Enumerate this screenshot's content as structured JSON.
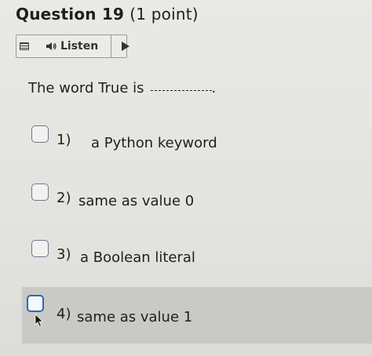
{
  "question": {
    "title": "Question 19",
    "points": "(1 point)",
    "prompt": "The word True is",
    "prompt_end": "."
  },
  "listen_bar": {
    "label": "Listen",
    "icons": [
      "menu-icon",
      "speaker-icon",
      "play-icon"
    ]
  },
  "options": [
    {
      "number": "1)",
      "text": "a Python keyword"
    },
    {
      "number": "2)",
      "text": "same as value 0"
    },
    {
      "number": "3)",
      "text": "a Boolean literal"
    },
    {
      "number": "4)",
      "text": "same as value 1"
    }
  ],
  "colors": {
    "radio_border": "#6a7b88",
    "radio_focus": "#1f6fb3",
    "hover_row": "#c9c9c6"
  }
}
